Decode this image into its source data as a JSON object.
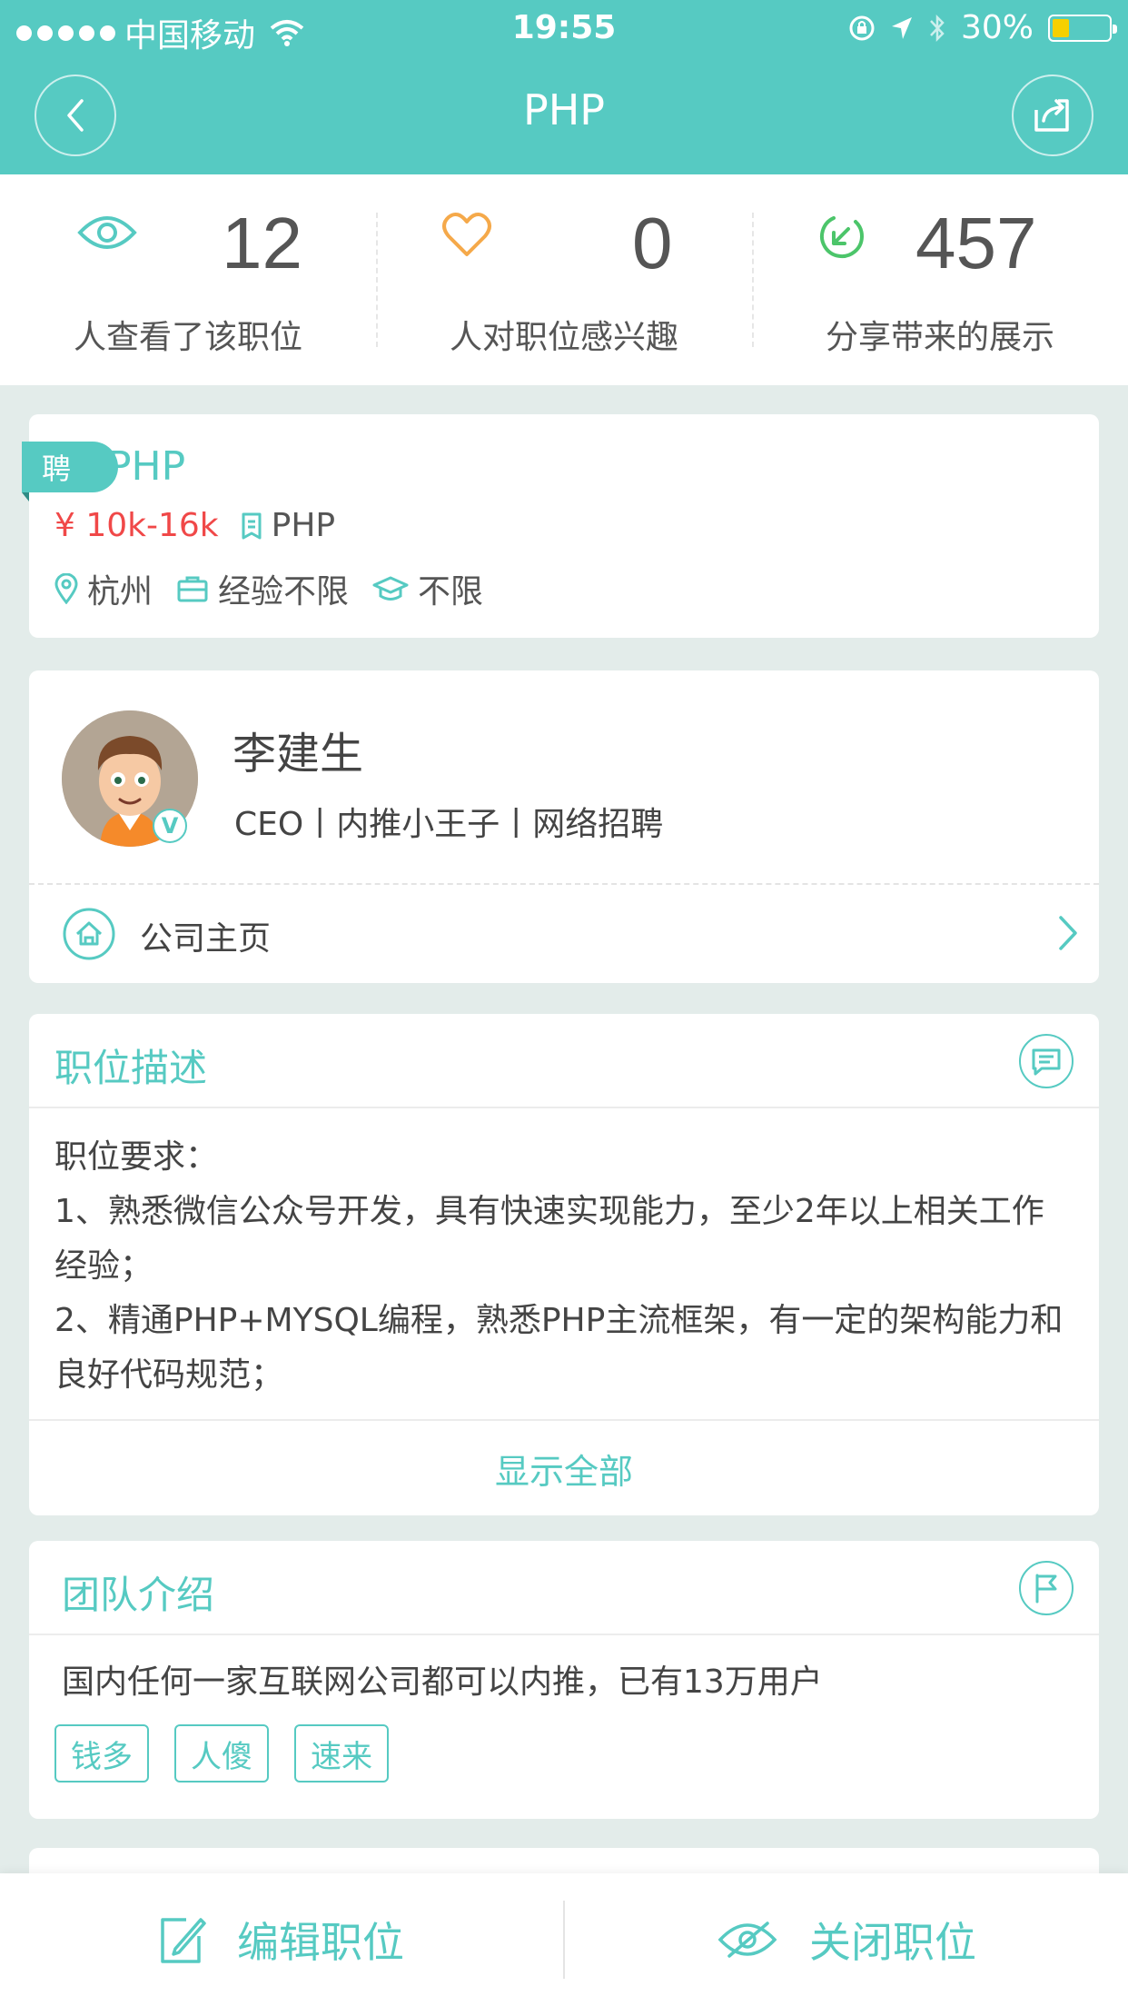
{
  "status_bar": {
    "carrier": "中国移动",
    "time": "19:55",
    "battery": "30%"
  },
  "header": {
    "title": "PHP",
    "back_icon": "chevron-left-icon",
    "share_icon": "share-icon"
  },
  "stats": [
    {
      "number": "12",
      "label": "人查看了该职位",
      "icon": "eye-icon"
    },
    {
      "number": "0",
      "label": "人对职位感兴趣",
      "icon": "heart-icon"
    },
    {
      "number": "457",
      "label": "分享带来的展示",
      "icon": "share-arrow-icon"
    }
  ],
  "job": {
    "tag": "聘",
    "title": "PHP",
    "salary": "¥ 10k-16k",
    "category": "PHP",
    "location": "杭州",
    "experience": "经验不限",
    "education": "不限"
  },
  "recruiter": {
    "name": "李建生",
    "title": "CEO丨内推小王子丨网络招聘",
    "verified": "V",
    "company_home": "公司主页"
  },
  "description": {
    "title": "职位描述",
    "lines": [
      "职位要求：",
      "1、熟悉微信公众号开发，具有快速实现能力，至少2年以上相关工作经验；",
      "2、精通PHP+MYSQL编程，熟悉PHP主流框架，有一定的架构能力和良好代码规范；"
    ],
    "show_all": "显示全部"
  },
  "team": {
    "title": "团队介绍",
    "text": "国内任何一家互联网公司都可以内推，已有13万用户",
    "tags": [
      "钱多",
      "人傻",
      "速来"
    ]
  },
  "bottom": {
    "edit": "编辑职位",
    "close": "关闭职位"
  },
  "colors": {
    "accent": "#56cac2",
    "salary": "#f04848",
    "heart": "#f5a94a",
    "share_green": "#4cc56a"
  }
}
